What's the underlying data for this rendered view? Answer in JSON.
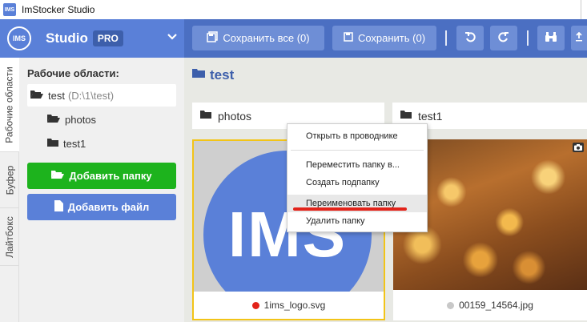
{
  "window": {
    "title": "ImStocker Studio",
    "icon_text": "IMS"
  },
  "header": {
    "logo_text": "IMS",
    "studio_label": "Studio",
    "pro_badge": "PRO"
  },
  "toolbar": {
    "save_all_label": "Сохранить все (0)",
    "save_label": "Сохранить (0)"
  },
  "side_tabs": [
    "Рабочие области",
    "Буфер",
    "Лайтбокс"
  ],
  "sidebar": {
    "heading": "Рабочие области:",
    "workspace": {
      "name": "test",
      "path": "(D:\\1\\test)"
    },
    "folders": [
      "photos",
      "test1"
    ],
    "add_folder_label": "Добавить папку",
    "add_file_label": "Добавить файл",
    "add_folder_color": "#1db31d",
    "add_file_color": "#5a80d8"
  },
  "main": {
    "title": "test",
    "folders": [
      "photos",
      "test1"
    ],
    "images": [
      {
        "name": "1ims_logo.svg",
        "status_color": "#e2231a",
        "thumb_text": "IMS"
      },
      {
        "name": "00159_14564.jpg",
        "status_color": "#c8c8c8"
      }
    ]
  },
  "context_menu": {
    "items": [
      "Открыть в проводнике",
      "Переместить папку в...",
      "Создать подпапку",
      "Переименовать папку",
      "Удалить папку"
    ]
  },
  "colors": {
    "accent": "#5a80d8",
    "toolbar_dark": "#4b6fc2",
    "selection": "#f2c418",
    "underline": "#e2231a"
  }
}
